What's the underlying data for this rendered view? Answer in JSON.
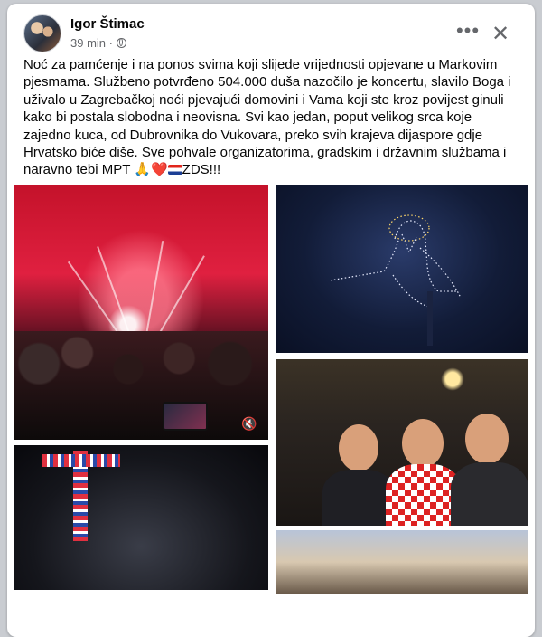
{
  "post": {
    "author": "Igor Štimac",
    "time": "39 min",
    "dot": "·",
    "text_main": "Noć za pamćenje i na ponos svima koji slijede vrijednosti opjevane u Markovim pjesmama. Službeno potvrđeno 504.000 duša nazočilo je koncertu, slavilo Boga i uživalo u Zagrebačkoj noći pjevajući domovini i Vama koji ste kroz povijest ginuli kako bi postala slobodna i neovisna. Svi kao jedan, poput velikog srca koje zajedno kuca, od Dubrovnika do Vukovara, preko svih krajeva dijaspore gdje Hrvatsko biće diše. Sve pohvale organizatorima, gradskim i državnim službama i naravno tebi MPT",
    "text_emoji": "🙏❤️",
    "text_end": "ZDS!!!"
  },
  "icons": {
    "more": "more-horizontal-icon",
    "close": "close-icon",
    "audience": "globe-icon",
    "mute": "mute-icon"
  },
  "colors": {
    "background": "#c9ccd1",
    "card": "#ffffff",
    "text": "#050505",
    "muted": "#65676b"
  }
}
